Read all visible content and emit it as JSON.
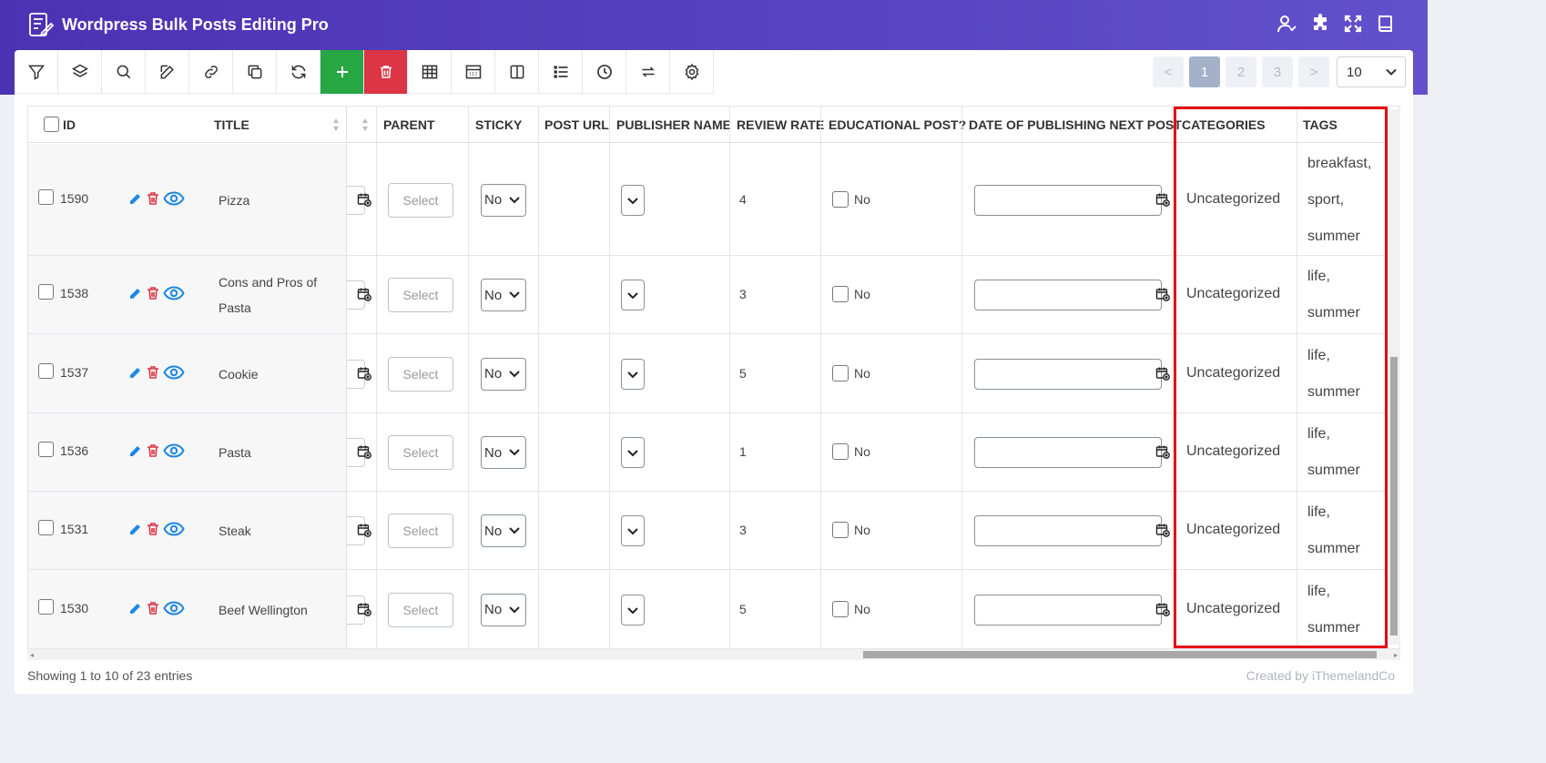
{
  "app": {
    "title": "Wordpress Bulk Posts Editing Pro"
  },
  "top_icons": [
    "user-check-icon",
    "puzzle-icon",
    "fullscreen-icon",
    "book-icon"
  ],
  "toolbar": {
    "tools": [
      "filter-icon",
      "layers-icon",
      "search-icon",
      "edit-icon",
      "link-icon",
      "duplicate-icon",
      "refresh-icon",
      "add-icon",
      "delete-icon",
      "table-icon",
      "grid-icon",
      "columns-icon",
      "list-icon",
      "history-icon",
      "swap-icon",
      "settings-icon"
    ]
  },
  "pagination": {
    "prev": "<",
    "pages": [
      "1",
      "2",
      "3"
    ],
    "next": ">",
    "active": "1",
    "per_page": "10"
  },
  "columns": {
    "id": "ID",
    "title": "TITLE",
    "parent": "PARENT",
    "sticky": "STICKY",
    "post_url": "POST URL",
    "publisher_name": "PUBLISHER NAME",
    "review_rate": "REVIEW RATE",
    "educational_post": "EDUCATIONAL POST?",
    "date_next_post": "DATE OF PUBLISHING NEXT POST",
    "categories": "CATEGORIES",
    "tags": "TAGS"
  },
  "rows": [
    {
      "id": "1590",
      "title": "Pizza",
      "parent": "Select",
      "sticky": "No",
      "review_rate": "4",
      "educational": "No",
      "category": "Uncategorized",
      "tags": [
        "breakfast,",
        "sport,",
        "summer"
      ]
    },
    {
      "id": "1538",
      "title": "Cons and Pros of Pasta",
      "parent": "Select",
      "sticky": "No",
      "review_rate": "3",
      "educational": "No",
      "category": "Uncategorized",
      "tags": [
        "life,",
        "summer"
      ]
    },
    {
      "id": "1537",
      "title": "Cookie",
      "parent": "Select",
      "sticky": "No",
      "review_rate": "5",
      "educational": "No",
      "category": "Uncategorized",
      "tags": [
        "life,",
        "summer"
      ]
    },
    {
      "id": "1536",
      "title": "Pasta",
      "parent": "Select",
      "sticky": "No",
      "review_rate": "1",
      "educational": "No",
      "category": "Uncategorized",
      "tags": [
        "life,",
        "summer"
      ]
    },
    {
      "id": "1531",
      "title": "Steak",
      "parent": "Select",
      "sticky": "No",
      "review_rate": "3",
      "educational": "No",
      "category": "Uncategorized",
      "tags": [
        "life,",
        "summer"
      ]
    },
    {
      "id": "1530",
      "title": "Beef Wellington",
      "parent": "Select",
      "sticky": "No",
      "review_rate": "5",
      "educational": "No",
      "category": "Uncategorized",
      "tags": [
        "life,",
        "summer"
      ]
    }
  ],
  "footer": {
    "entries": "Showing 1 to 10 of 23 entries",
    "credit": "Created by iThemelandCo"
  },
  "colors": {
    "header": "#4a33b3",
    "add": "#28a745",
    "delete": "#dc3545",
    "highlight": "#e60012",
    "edit": "#1e88e5"
  }
}
